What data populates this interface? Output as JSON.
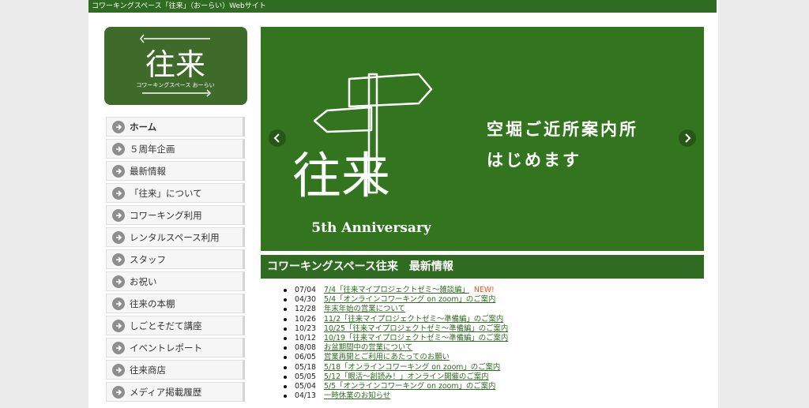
{
  "site": {
    "header_text": "コワーキングスペース「往来」（おーらい）Webサイト",
    "logo": {
      "main": "往来",
      "sub": "コワーキングスペース おーらい"
    }
  },
  "nav": {
    "items": [
      {
        "label": "ホーム"
      },
      {
        "label": "５周年企画"
      },
      {
        "label": "最新情報"
      },
      {
        "label": "「往来」について"
      },
      {
        "label": "コワーキング利用"
      },
      {
        "label": "レンタルスペース利用"
      },
      {
        "label": "スタッフ"
      },
      {
        "label": "お祝い"
      },
      {
        "label": "往来の本棚"
      },
      {
        "label": "しごとそだて講座"
      },
      {
        "label": "イベントレポート"
      },
      {
        "label": "往来商店"
      },
      {
        "label": "メディア掲載履歴"
      }
    ]
  },
  "slider": {
    "logo_text": "往来",
    "anniversary": "5th Anniversary",
    "line1": "空堀ご近所案内所",
    "line2": "はじめます",
    "icons": {
      "prev": "chevron-left-icon",
      "next": "chevron-right-icon"
    },
    "bg_color": "#33751f"
  },
  "news": {
    "title": "コワーキングスペース往来　最新情報",
    "new_label": "NEW!",
    "items": [
      {
        "date": "07/04",
        "text": "7/4「往来マイプロジェクトゼミ～雑談編」"
      },
      {
        "date": "04/30",
        "text": "5/4「オンラインコワーキング on zoom」のご案内"
      },
      {
        "date": "12/28",
        "text": "年末年始の営業について"
      },
      {
        "date": "10/26",
        "text": "11/2「往来マイプロジェクトゼミ～準備編」のご案内"
      },
      {
        "date": "10/23",
        "text": "10/25「往来マイプロジェクトゼミ～準備編」のご案内"
      },
      {
        "date": "10/12",
        "text": "10/19「往来マイプロジェクトゼミ～準備編」のご案内"
      },
      {
        "date": "08/08",
        "text": "お盆期間中の営業について"
      },
      {
        "date": "06/05",
        "text": "営業再開とご利用にあたってのお願い"
      },
      {
        "date": "05/18",
        "text": "5/18「オンラインコワーキング on zoom」のご案内"
      },
      {
        "date": "05/05",
        "text": "5/12「眼活～創読み！」オンライン開催のご案内"
      },
      {
        "date": "05/04",
        "text": "5/5「オンラインコワーキング on zoom」のご案内"
      },
      {
        "date": "04/13",
        "text": "一時休業のお知らせ"
      }
    ]
  },
  "colors": {
    "brand_green": "#2f6b21",
    "new_orange": "#e8541c"
  }
}
